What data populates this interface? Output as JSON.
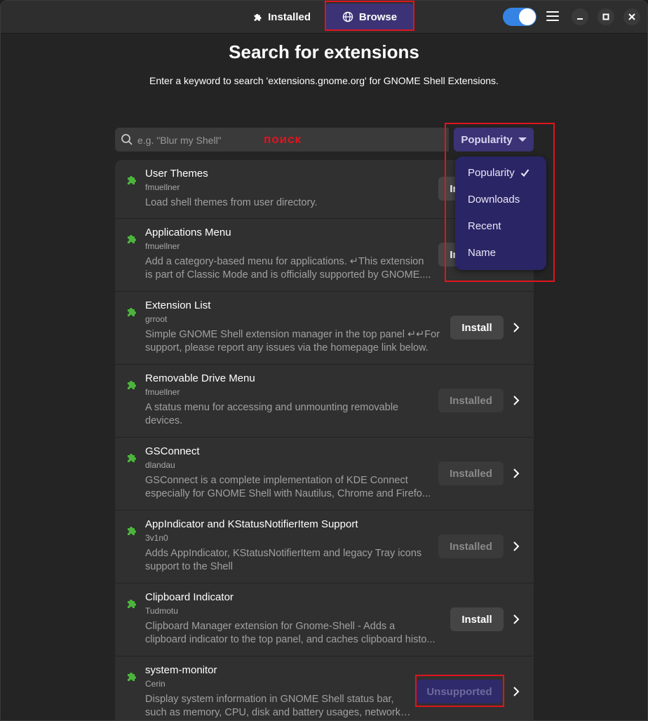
{
  "header": {
    "tabs": [
      {
        "label": "Installed",
        "icon": "puzzle-icon"
      },
      {
        "label": "Browse",
        "icon": "globe-icon",
        "active": true
      }
    ],
    "toggle_on": true,
    "accent": "#3584e4"
  },
  "main": {
    "title": "Search for extensions",
    "subtitle": "Enter a keyword to search 'extensions.gnome.org' for GNOME Shell Extensions.",
    "search": {
      "placeholder": "e.g. \"Blur my Shell\"",
      "annotation": "поиск"
    },
    "sort": {
      "label": "Popularity",
      "options": [
        "Popularity",
        "Downloads",
        "Recent",
        "Name"
      ],
      "selected": "Popularity"
    }
  },
  "extensions": [
    {
      "name": "User Themes",
      "author": "fmuellner",
      "desc1": "Load shell themes from user directory.",
      "desc2": "",
      "action": "Install"
    },
    {
      "name": "Applications Menu",
      "author": "fmuellner",
      "desc1": "Add a category-based menu for applications. ↵This extension",
      "desc2": "is part of Classic Mode and is officially supported by GNOME....",
      "action": "Install"
    },
    {
      "name": "Extension List",
      "author": "grroot",
      "desc1": "Simple GNOME Shell extension manager in the top panel ↵↵For",
      "desc2": "support, please report any issues via the homepage link below.",
      "action": "Install"
    },
    {
      "name": "Removable Drive Menu",
      "author": "fmuellner",
      "desc1": "A status menu for accessing and unmounting removable",
      "desc2": "devices.",
      "action": "Installed"
    },
    {
      "name": "GSConnect",
      "author": "dlandau",
      "desc1": "GSConnect is a complete implementation of KDE Connect",
      "desc2": "especially for GNOME Shell with Nautilus, Chrome and Firefo...",
      "action": "Installed"
    },
    {
      "name": "AppIndicator and KStatusNotifierItem Support",
      "author": "3v1n0",
      "desc1": "Adds AppIndicator, KStatusNotifierItem and legacy Tray icons",
      "desc2": "support to the Shell",
      "action": "Installed"
    },
    {
      "name": "Clipboard Indicator",
      "author": "Tudmotu",
      "desc1": "Clipboard Manager extension for Gnome-Shell - Adds a",
      "desc2": "clipboard indicator to the top panel, and caches clipboard histo...",
      "action": "Install"
    },
    {
      "name": "system-monitor",
      "author": "Cerin",
      "desc1": "Display system information in GNOME Shell status bar,",
      "desc2": "such as memory, CPU, disk and battery usages, network ...",
      "action": "Unsupported"
    }
  ]
}
